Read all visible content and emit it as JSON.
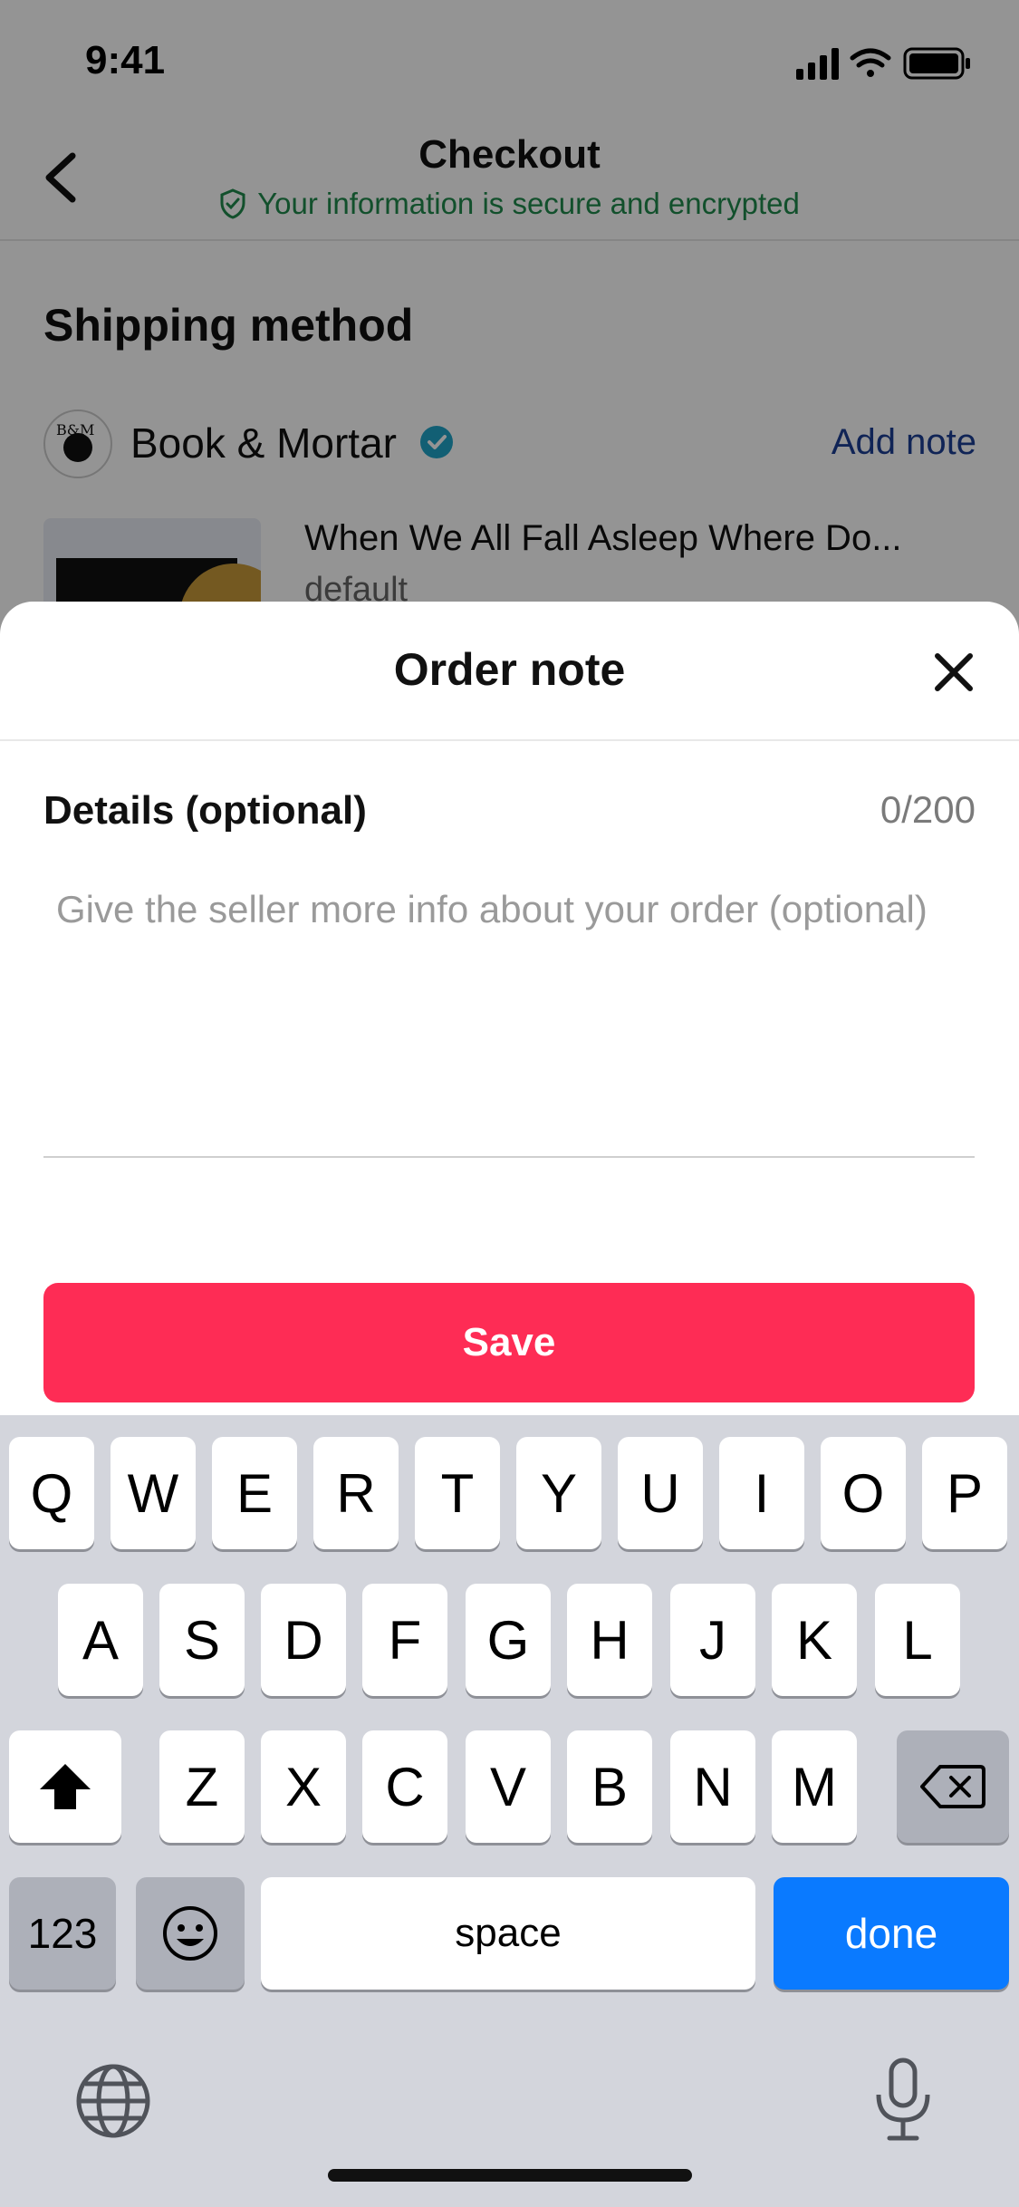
{
  "status_bar": {
    "time": "9:41"
  },
  "header": {
    "title": "Checkout",
    "secure_text": "Your information is secure and encrypted"
  },
  "shipping": {
    "section_title": "Shipping method",
    "store_name": "Book & Mortar",
    "add_note_label": "Add note",
    "product_title": "When We All Fall Asleep Where Do...",
    "product_variant": "default"
  },
  "sheet": {
    "title": "Order note",
    "details_label": "Details (optional)",
    "char_count": "0/200",
    "note_value": "",
    "note_placeholder": "Give the seller more info about your order (optional)",
    "save_label": "Save"
  },
  "keyboard": {
    "row1": [
      "Q",
      "W",
      "E",
      "R",
      "T",
      "Y",
      "U",
      "I",
      "O",
      "P"
    ],
    "row2": [
      "A",
      "S",
      "D",
      "F",
      "G",
      "H",
      "J",
      "K",
      "L"
    ],
    "row3": [
      "Z",
      "X",
      "C",
      "V",
      "B",
      "N",
      "M"
    ],
    "numbers_label": "123",
    "space_label": "space",
    "done_label": "done"
  },
  "colors": {
    "accent": "#fe2c55",
    "secure_green": "#1f8a4c",
    "link_blue": "#1c3f94",
    "done_blue": "#0a7aff",
    "verified_teal": "#20a4c8"
  },
  "icons": [
    "back-arrow-icon",
    "shield-check-icon",
    "verified-badge-icon",
    "close-icon",
    "shift-icon",
    "backspace-icon",
    "emoji-icon",
    "globe-icon",
    "microphone-icon"
  ]
}
